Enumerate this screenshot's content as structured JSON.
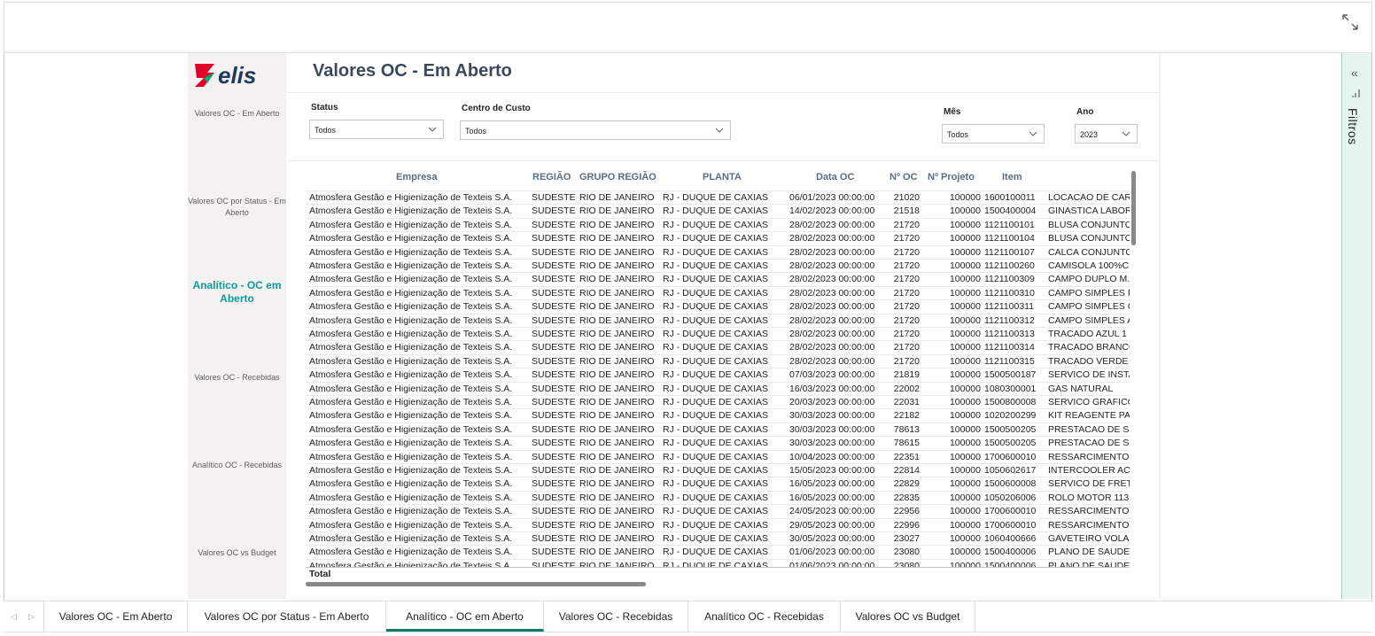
{
  "report": {
    "title": "Valores OC - Em Aberto"
  },
  "nav": {
    "items": [
      {
        "label": "Valores OC - Em Aberto"
      },
      {
        "label": "Valores OC por Status - Em Aberto"
      },
      {
        "label": "Analítico - OC em Aberto"
      },
      {
        "label": "Valores OC - Recebidas"
      },
      {
        "label": "Analítico OC - Recebidas"
      },
      {
        "label": "Valores OC vs Budget"
      }
    ],
    "active_index": 2
  },
  "slicers": {
    "status": {
      "label": "Status",
      "value": "Todos"
    },
    "centro_custo": {
      "label": "Centro de Custo",
      "value": "Todos"
    },
    "mes": {
      "label": "Mês",
      "value": "Todos"
    },
    "ano": {
      "label": "Ano",
      "value": "2023"
    }
  },
  "table": {
    "columns": [
      "Empresa",
      "REGIÃO",
      "GRUPO REGIÃO",
      "PLANTA",
      "Data OC",
      "Nº OC",
      "Nº Projeto",
      "Item"
    ],
    "rows": [
      [
        "Atmosfera Gestão e Higienização de Texteis S.A.",
        "SUDESTE",
        "RIO DE JANEIRO",
        "RJ - DUQUE DE CAXIAS",
        "06/01/2023 00:00:00",
        "21020",
        "100000",
        "1600100011",
        "LOCACAO DE CAR"
      ],
      [
        "Atmosfera Gestão e Higienização de Texteis S.A.",
        "SUDESTE",
        "RIO DE JANEIRO",
        "RJ - DUQUE DE CAXIAS",
        "14/02/2023 00:00:00",
        "21518",
        "100000",
        "1500400004",
        "GINASTICA LABOR"
      ],
      [
        "Atmosfera Gestão e Higienização de Texteis S.A.",
        "SUDESTE",
        "RIO DE JANEIRO",
        "RJ - DUQUE DE CAXIAS",
        "28/02/2023 00:00:00",
        "21720",
        "100000",
        "1121100101",
        "BLUSA CONJUNTO"
      ],
      [
        "Atmosfera Gestão e Higienização de Texteis S.A.",
        "SUDESTE",
        "RIO DE JANEIRO",
        "RJ - DUQUE DE CAXIAS",
        "28/02/2023 00:00:00",
        "21720",
        "100000",
        "1121100104",
        "BLUSA CONJUNTO"
      ],
      [
        "Atmosfera Gestão e Higienização de Texteis S.A.",
        "SUDESTE",
        "RIO DE JANEIRO",
        "RJ - DUQUE DE CAXIAS",
        "28/02/2023 00:00:00",
        "21720",
        "100000",
        "1121100107",
        "CALCA CONJUNTO"
      ],
      [
        "Atmosfera Gestão e Higienização de Texteis S.A.",
        "SUDESTE",
        "RIO DE JANEIRO",
        "RJ - DUQUE DE CAXIAS",
        "28/02/2023 00:00:00",
        "21720",
        "100000",
        "1121100260",
        "CAMISOLA 100%C"
      ],
      [
        "Atmosfera Gestão e Higienização de Texteis S.A.",
        "SUDESTE",
        "RIO DE JANEIRO",
        "RJ - DUQUE DE CAXIAS",
        "28/02/2023 00:00:00",
        "21720",
        "100000",
        "1121100309",
        "CAMPO DUPLO M."
      ],
      [
        "Atmosfera Gestão e Higienização de Texteis S.A.",
        "SUDESTE",
        "RIO DE JANEIRO",
        "RJ - DUQUE DE CAXIAS",
        "28/02/2023 00:00:00",
        "21720",
        "100000",
        "1121100310",
        "CAMPO SIMPLES F"
      ],
      [
        "Atmosfera Gestão e Higienização de Texteis S.A.",
        "SUDESTE",
        "RIO DE JANEIRO",
        "RJ - DUQUE DE CAXIAS",
        "28/02/2023 00:00:00",
        "21720",
        "100000",
        "1121100311",
        "CAMPO SIMPLES C"
      ],
      [
        "Atmosfera Gestão e Higienização de Texteis S.A.",
        "SUDESTE",
        "RIO DE JANEIRO",
        "RJ - DUQUE DE CAXIAS",
        "28/02/2023 00:00:00",
        "21720",
        "100000",
        "1121100312",
        "CAMPO SIMPLES A"
      ],
      [
        "Atmosfera Gestão e Higienização de Texteis S.A.",
        "SUDESTE",
        "RIO DE JANEIRO",
        "RJ - DUQUE DE CAXIAS",
        "28/02/2023 00:00:00",
        "21720",
        "100000",
        "1121100313",
        "TRACADO AZUL 1"
      ],
      [
        "Atmosfera Gestão e Higienização de Texteis S.A.",
        "SUDESTE",
        "RIO DE JANEIRO",
        "RJ - DUQUE DE CAXIAS",
        "28/02/2023 00:00:00",
        "21720",
        "100000",
        "1121100314",
        "TRACADO BRANCO"
      ],
      [
        "Atmosfera Gestão e Higienização de Texteis S.A.",
        "SUDESTE",
        "RIO DE JANEIRO",
        "RJ - DUQUE DE CAXIAS",
        "28/02/2023 00:00:00",
        "21720",
        "100000",
        "1121100315",
        "TRACADO VERDE"
      ],
      [
        "Atmosfera Gestão e Higienização de Texteis S.A.",
        "SUDESTE",
        "RIO DE JANEIRO",
        "RJ - DUQUE DE CAXIAS",
        "07/03/2023 00:00:00",
        "21819",
        "100000",
        "1500500187",
        "SERVICO DE INSTA"
      ],
      [
        "Atmosfera Gestão e Higienização de Texteis S.A.",
        "SUDESTE",
        "RIO DE JANEIRO",
        "RJ - DUQUE DE CAXIAS",
        "16/03/2023 00:00:00",
        "22002",
        "100000",
        "1080300001",
        "GAS NATURAL"
      ],
      [
        "Atmosfera Gestão e Higienização de Texteis S.A.",
        "SUDESTE",
        "RIO DE JANEIRO",
        "RJ - DUQUE DE CAXIAS",
        "20/03/2023 00:00:00",
        "22031",
        "100000",
        "1500800008",
        "SERVICO GRAFICO"
      ],
      [
        "Atmosfera Gestão e Higienização de Texteis S.A.",
        "SUDESTE",
        "RIO DE JANEIRO",
        "RJ - DUQUE DE CAXIAS",
        "30/03/2023 00:00:00",
        "22182",
        "100000",
        "1020200299",
        "KIT REAGENTE PAR"
      ],
      [
        "Atmosfera Gestão e Higienização de Texteis S.A.",
        "SUDESTE",
        "RIO DE JANEIRO",
        "RJ - DUQUE DE CAXIAS",
        "30/03/2023 00:00:00",
        "78613",
        "100000",
        "1500500205",
        "PRESTACAO DE SE"
      ],
      [
        "Atmosfera Gestão e Higienização de Texteis S.A.",
        "SUDESTE",
        "RIO DE JANEIRO",
        "RJ - DUQUE DE CAXIAS",
        "30/03/2023 00:00:00",
        "78615",
        "100000",
        "1500500205",
        "PRESTACAO DE SE"
      ],
      [
        "Atmosfera Gestão e Higienização de Texteis S.A.",
        "SUDESTE",
        "RIO DE JANEIRO",
        "RJ - DUQUE DE CAXIAS",
        "10/04/2023 00:00:00",
        "22351",
        "100000",
        "1700600010",
        "RESSARCIMENTO I"
      ],
      [
        "Atmosfera Gestão e Higienização de Texteis S.A.",
        "SUDESTE",
        "RIO DE JANEIRO",
        "RJ - DUQUE DE CAXIAS",
        "15/05/2023 00:00:00",
        "22814",
        "100000",
        "1050602617",
        "INTERCOOLER ACC"
      ],
      [
        "Atmosfera Gestão e Higienização de Texteis S.A.",
        "SUDESTE",
        "RIO DE JANEIRO",
        "RJ - DUQUE DE CAXIAS",
        "16/05/2023 00:00:00",
        "22829",
        "100000",
        "1500600008",
        "SERVICO DE FRETE"
      ],
      [
        "Atmosfera Gestão e Higienização de Texteis S.A.",
        "SUDESTE",
        "RIO DE JANEIRO",
        "RJ - DUQUE DE CAXIAS",
        "16/05/2023 00:00:00",
        "22835",
        "100000",
        "1050206006",
        "ROLO MOTOR 113"
      ],
      [
        "Atmosfera Gestão e Higienização de Texteis S.A.",
        "SUDESTE",
        "RIO DE JANEIRO",
        "RJ - DUQUE DE CAXIAS",
        "24/05/2023 00:00:00",
        "22956",
        "100000",
        "1700600010",
        "RESSARCIMENTO I"
      ],
      [
        "Atmosfera Gestão e Higienização de Texteis S.A.",
        "SUDESTE",
        "RIO DE JANEIRO",
        "RJ - DUQUE DE CAXIAS",
        "29/05/2023 00:00:00",
        "22996",
        "100000",
        "1700600010",
        "RESSARCIMENTO I"
      ],
      [
        "Atmosfera Gestão e Higienização de Texteis S.A.",
        "SUDESTE",
        "RIO DE JANEIRO",
        "RJ - DUQUE DE CAXIAS",
        "30/05/2023 00:00:00",
        "23027",
        "100000",
        "1060400666",
        "GAVETEIRO VOLAN"
      ],
      [
        "Atmosfera Gestão e Higienização de Texteis S.A.",
        "SUDESTE",
        "RIO DE JANEIRO",
        "RJ - DUQUE DE CAXIAS",
        "01/06/2023 00:00:00",
        "23080",
        "100000",
        "1500400006",
        "PLANO DE SAUDE"
      ],
      [
        "Atmosfera Gestão e Higienização de Texteis S.A.",
        "SUDESTE",
        "RIO DE JANEIRO",
        "RJ - DUQUE DE CAXIAS",
        "01/06/2023 00:00:00",
        "23080",
        "100000",
        "1500400006",
        "PLANO DE SAUDE"
      ]
    ],
    "total_label": "Total"
  },
  "filters_pane": {
    "label": "Filtros",
    "collapse_glyph": "«"
  },
  "tabs": {
    "items": [
      {
        "label": "Valores OC - Em Aberto"
      },
      {
        "label": "Valores OC por Status - Em Aberto"
      },
      {
        "label": "Analítico - OC em Aberto"
      },
      {
        "label": "Valores OC - Recebidas"
      },
      {
        "label": "Analítico OC - Recebidas"
      },
      {
        "label": "Valores OC vs Budget"
      }
    ],
    "active_index": 2
  },
  "icons": {
    "expand": "expand-icon",
    "chevron": "chevron-down-icon",
    "filter": "filter-icon",
    "logo": "elis-logo"
  },
  "colors": {
    "accent": "#0c9c9c",
    "tab_active": "#117865",
    "logo_red": "#e4002b",
    "logo_green": "#00a870",
    "logo_text": "#1f3a5a"
  }
}
